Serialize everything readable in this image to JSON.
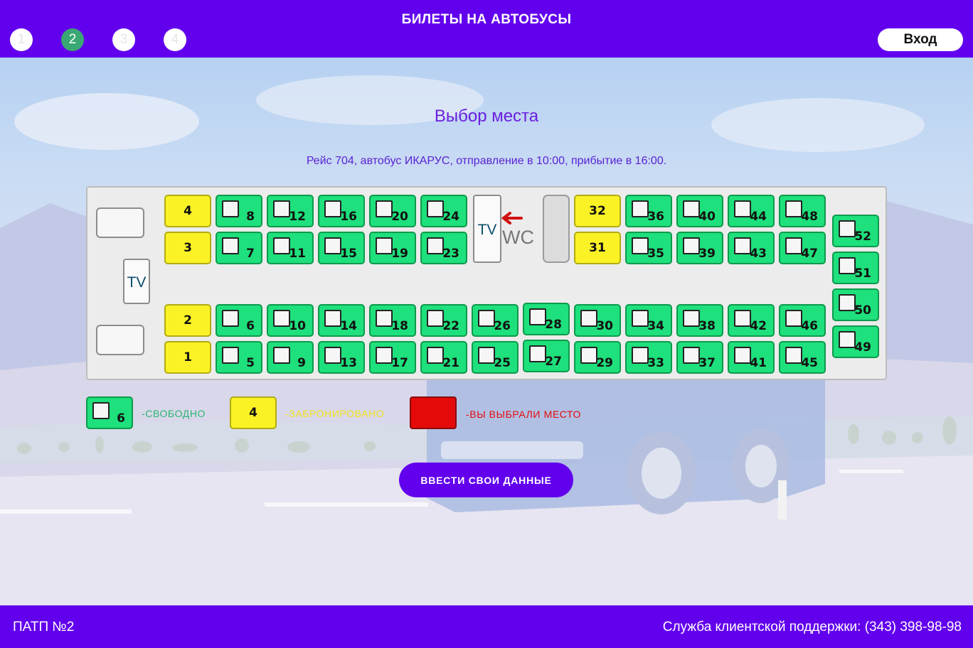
{
  "header": {
    "title": "БИЛЕТЫ НА АВТОБУСЫ",
    "steps": [
      "1",
      "2",
      "3",
      "4"
    ],
    "active_step": 2,
    "login_label": "Вход"
  },
  "page": {
    "title": "Выбор места",
    "trip_info": "Рейс 704, автобус ИКАРУС, отправление в 10:00, прибытие в 16:00."
  },
  "bus": {
    "tv_label": "TV",
    "wc_label": "WC",
    "booked_seats": [
      1,
      2,
      3,
      4,
      31,
      32
    ],
    "seats": [
      {
        "number": "4",
        "status": "booked"
      },
      {
        "number": "8",
        "status": "free"
      },
      {
        "number": "12",
        "status": "free"
      },
      {
        "number": "16",
        "status": "free"
      },
      {
        "number": "20",
        "status": "free"
      },
      {
        "number": "24",
        "status": "free"
      },
      {
        "number": "32",
        "status": "booked"
      },
      {
        "number": "36",
        "status": "free"
      },
      {
        "number": "40",
        "status": "free"
      },
      {
        "number": "44",
        "status": "free"
      },
      {
        "number": "48",
        "status": "free"
      },
      {
        "number": "3",
        "status": "booked"
      },
      {
        "number": "7",
        "status": "free"
      },
      {
        "number": "11",
        "status": "free"
      },
      {
        "number": "15",
        "status": "free"
      },
      {
        "number": "19",
        "status": "free"
      },
      {
        "number": "23",
        "status": "free"
      },
      {
        "number": "31",
        "status": "booked"
      },
      {
        "number": "35",
        "status": "free"
      },
      {
        "number": "39",
        "status": "free"
      },
      {
        "number": "43",
        "status": "free"
      },
      {
        "number": "47",
        "status": "free"
      },
      {
        "number": "2",
        "status": "booked"
      },
      {
        "number": "6",
        "status": "free"
      },
      {
        "number": "10",
        "status": "free"
      },
      {
        "number": "14",
        "status": "free"
      },
      {
        "number": "18",
        "status": "free"
      },
      {
        "number": "22",
        "status": "free"
      },
      {
        "number": "26",
        "status": "free"
      },
      {
        "number": "28",
        "status": "free"
      },
      {
        "number": "30",
        "status": "free"
      },
      {
        "number": "34",
        "status": "free"
      },
      {
        "number": "38",
        "status": "free"
      },
      {
        "number": "42",
        "status": "free"
      },
      {
        "number": "46",
        "status": "free"
      },
      {
        "number": "1",
        "status": "booked"
      },
      {
        "number": "5",
        "status": "free"
      },
      {
        "number": "9",
        "status": "free"
      },
      {
        "number": "13",
        "status": "free"
      },
      {
        "number": "17",
        "status": "free"
      },
      {
        "number": "21",
        "status": "free"
      },
      {
        "number": "25",
        "status": "free"
      },
      {
        "number": "27",
        "status": "free"
      },
      {
        "number": "29",
        "status": "free"
      },
      {
        "number": "33",
        "status": "free"
      },
      {
        "number": "37",
        "status": "free"
      },
      {
        "number": "41",
        "status": "free"
      },
      {
        "number": "45",
        "status": "free"
      },
      {
        "number": "52",
        "status": "free"
      },
      {
        "number": "51",
        "status": "free"
      },
      {
        "number": "50",
        "status": "free"
      },
      {
        "number": "49",
        "status": "free"
      }
    ]
  },
  "legend": {
    "free_sample_number": "6",
    "free_label": "-СВОБОДНО",
    "booked_sample_number": "4",
    "booked_label": "-ЗАБРОНИРОВАНО",
    "selected_label": "-ВЫ ВЫБРАЛИ МЕСТО",
    "free_color": "#1ee07c",
    "booked_color": "#fbf226",
    "selected_color": "#e40a0a"
  },
  "actions": {
    "submit_label": "ВВЕСТИ СВОИ ДАННЫЕ"
  },
  "footer": {
    "left_text": "ПАТП №2",
    "right_text": "Служба клиентской поддержки: (343) 398-98-98"
  },
  "colors": {
    "brand": "#6200ee",
    "active_step": "#3aa873",
    "title_text": "#6a1fe0"
  }
}
